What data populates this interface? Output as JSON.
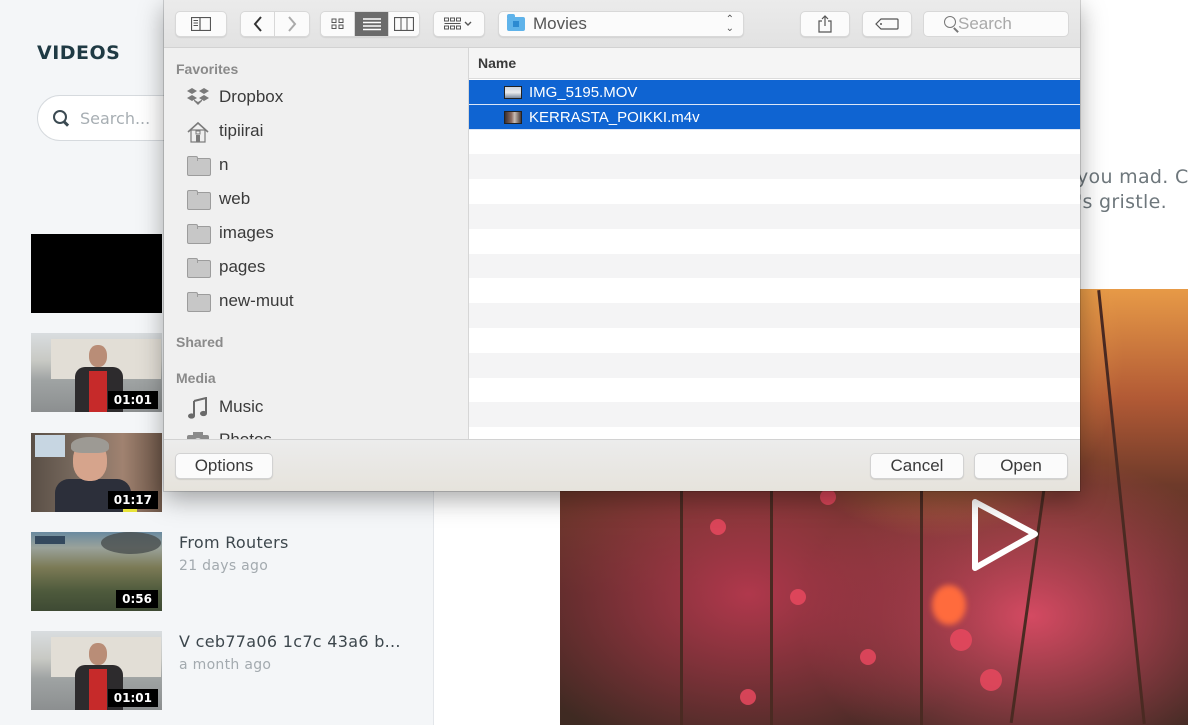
{
  "app": {
    "section_title": "VIDEOS",
    "search": {
      "placeholder": "Search...",
      "value": ""
    },
    "videos": [
      {
        "thumbnail": "black",
        "duration": "",
        "title": "",
        "meta": ""
      },
      {
        "thumbnail": "street-interview",
        "duration": "01:01",
        "title": "",
        "meta": ""
      },
      {
        "thumbnail": "office-interview",
        "duration": "01:17",
        "title": "",
        "meta": ""
      },
      {
        "thumbnail": "field-scene",
        "duration": "0:56",
        "title": "From Routers",
        "meta": "21 days ago"
      },
      {
        "thumbnail": "street-interview",
        "duration": "01:01",
        "title": "V ceb77a06 1c7c 43a6 b...",
        "meta": "a month ago"
      }
    ],
    "description_lines": [
      "you mad. C",
      "'s gristle."
    ],
    "player": {
      "icon": "play-icon",
      "accent": "#ffffff"
    }
  },
  "dialog": {
    "toolbar": {
      "sidebar_toggle_icon": "sidebar-icon",
      "back_icon": "chevron-left-icon",
      "forward_icon": "chevron-right-icon",
      "view_modes": [
        {
          "name": "icon-view",
          "icon": "grid-icon",
          "selected": false
        },
        {
          "name": "list-view",
          "icon": "list-icon",
          "selected": true
        },
        {
          "name": "column-view",
          "icon": "columns-icon",
          "selected": false
        }
      ],
      "group_icon": "group-by-icon",
      "location": "Movies",
      "share_icon": "share-icon",
      "tag_icon": "tag-icon",
      "search_placeholder": "Search",
      "search_value": ""
    },
    "sidebar": {
      "sections": [
        {
          "title": "Favorites",
          "items": [
            {
              "label": "Dropbox",
              "icon": "dropbox-icon"
            },
            {
              "label": "tipiirai",
              "icon": "home-icon"
            },
            {
              "label": "n",
              "icon": "folder-icon"
            },
            {
              "label": "web",
              "icon": "folder-icon"
            },
            {
              "label": "images",
              "icon": "folder-icon"
            },
            {
              "label": "pages",
              "icon": "folder-icon"
            },
            {
              "label": "new-muut",
              "icon": "folder-icon"
            }
          ]
        },
        {
          "title": "Shared",
          "items": []
        },
        {
          "title": "Media",
          "items": [
            {
              "label": "Music",
              "icon": "music-icon"
            },
            {
              "label": "Photos",
              "icon": "camera-icon"
            }
          ]
        }
      ]
    },
    "file_list": {
      "column_header": "Name",
      "files": [
        {
          "name": "IMG_5195.MOV",
          "icon": "mov-file-icon",
          "selected": true
        },
        {
          "name": "KERRASTA_POIKKI.m4v",
          "icon": "m4v-file-icon",
          "selected": true
        }
      ],
      "selection_color": "#0f64d2"
    },
    "footer": {
      "options_label": "Options",
      "cancel_label": "Cancel",
      "open_label": "Open"
    }
  }
}
